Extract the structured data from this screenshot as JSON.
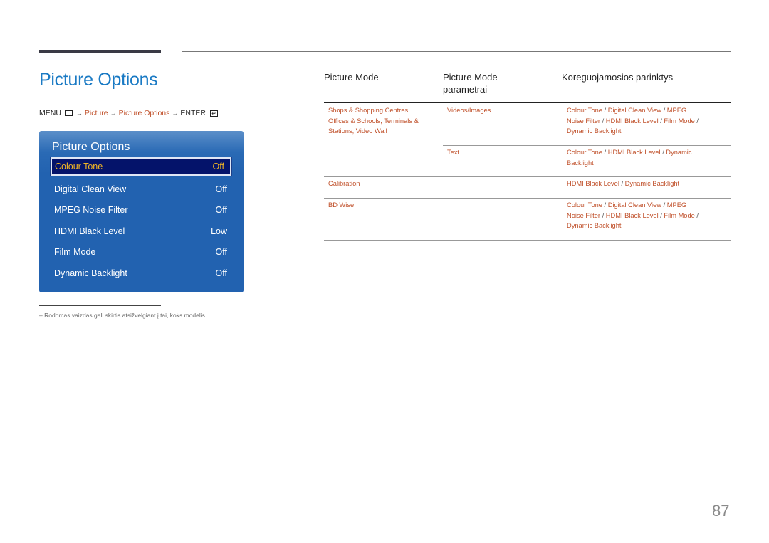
{
  "header": {
    "title": "Picture Options"
  },
  "menu_path": {
    "menu_label": "MENU",
    "menu_icon": "menu-grid-icon",
    "arrow": "→",
    "step1": "Picture",
    "step2": "Picture Options",
    "enter_label": "ENTER",
    "enter_icon": "enter-icon"
  },
  "osd": {
    "title": "Picture Options",
    "items": [
      {
        "label": "Colour Tone",
        "value": "Off",
        "selected": true
      },
      {
        "label": "Digital Clean View",
        "value": "Off"
      },
      {
        "label": "MPEG Noise Filter",
        "value": "Off"
      },
      {
        "label": "HDMI Black Level",
        "value": "Low"
      },
      {
        "label": "Film Mode",
        "value": "Off"
      },
      {
        "label": "Dynamic Backlight",
        "value": "Off"
      }
    ]
  },
  "footnote": "–  Rodomas vaizdas gali skirtis atsižvelgiant į tai, koks modelis.",
  "table": {
    "headers": [
      "Picture Mode",
      "Picture Mode parametrai",
      "Koreguojamosios parinktys"
    ],
    "header_lines": {
      "col2_line1": "Picture Mode",
      "col2_line2": "parametrai"
    },
    "rows": [
      {
        "mode_lines": [
          "Shops & Shopping Centres,",
          "Offices & Schools, Terminals &",
          "Stations, Video Wall"
        ],
        "param": "Videos/Images",
        "options_lines": [
          "Colour Tone / Digital Clean View / MPEG",
          "Noise Filter / HDMI Black Level / Film Mode /",
          "Dynamic Backlight"
        ]
      },
      {
        "mode_lines": [],
        "param": "Text",
        "options_lines": [
          "Colour Tone / HDMI Black Level / Dynamic",
          "Backlight"
        ]
      },
      {
        "mode_lines": [
          "Calibration"
        ],
        "param": "",
        "options_lines": [
          "HDMI Black Level / Dynamic Backlight"
        ]
      },
      {
        "mode_lines": [
          "BD Wise"
        ],
        "param": "",
        "options_lines": [
          "Colour Tone / Digital Clean View / MPEG",
          "Noise Filter / HDMI Black Level / Film Mode /",
          "Dynamic Backlight"
        ]
      }
    ]
  },
  "colors": {
    "title_blue": "#1a7ac4",
    "link_orange": "#c0502a",
    "osd_blue": "#2262b0",
    "osd_selected_bg": "#04136a",
    "osd_selected_text": "#f0b526"
  },
  "page_number": "87"
}
